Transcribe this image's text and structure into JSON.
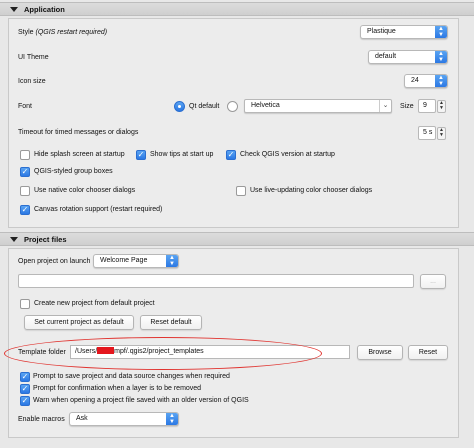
{
  "application": {
    "section_title": "Application",
    "style_label": "Style",
    "style_note": "(QGIS restart required)",
    "style_value": "Plastique",
    "ui_theme_label": "UI Theme",
    "ui_theme_value": "default",
    "icon_size_label": "Icon size",
    "icon_size_value": "24",
    "font_label": "Font",
    "font_qt_default_label": "Qt default",
    "font_family_value": "Helvetica",
    "font_size_label": "Size",
    "font_size_value": "9",
    "timeout_label": "Timeout for timed messages or dialogs",
    "timeout_value": "5 s",
    "checks": {
      "hide_splash": "Hide splash screen at startup",
      "show_tips": "Show tips at start up",
      "check_version": "Check QGIS version at startup",
      "group_boxes": "QGIS-styled group boxes",
      "native_chooser": "Use native color chooser dialogs",
      "live_chooser": "Use live-updating color chooser dialogs",
      "canvas_rotation": "Canvas rotation support (restart required)"
    }
  },
  "project_files": {
    "section_title": "Project files",
    "open_on_launch_label": "Open project on launch",
    "open_on_launch_value": "Welcome Page",
    "browse_dots_label": "...",
    "create_from_default_label": "Create new project from default project",
    "set_current_default_label": "Set current project as default",
    "reset_default_label": "Reset default",
    "template_folder_label": "Template folder",
    "template_path_prefix": "/Users/",
    "template_path_suffix": "mpf/.qgis2/project_templates",
    "browse_label": "Browse",
    "reset_label": "Reset",
    "prompt_save_label": "Prompt to save project and data source changes when required",
    "prompt_remove_label": "Prompt for confirmation when a layer is to be removed",
    "warn_older_label": "Warn when opening a project file saved with an older version of QGIS",
    "enable_macros_label": "Enable macros",
    "enable_macros_value": "Ask"
  },
  "colors": {
    "accent": "#2b78e4",
    "highlight_oval": "#e0332f",
    "redaction": "#e4161d"
  }
}
